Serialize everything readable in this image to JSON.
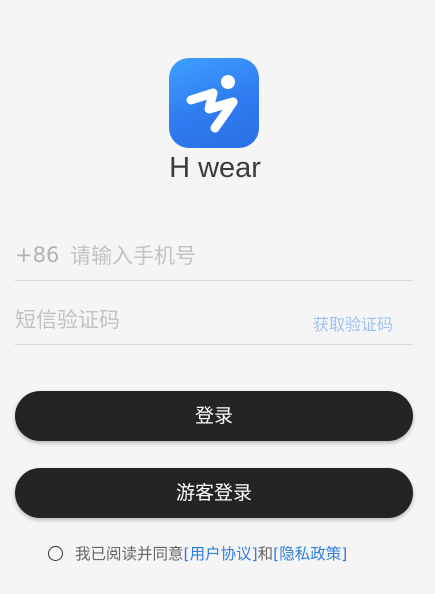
{
  "app": {
    "name": "H wear",
    "icon": "h-wear-logo-icon",
    "icon_color": "#3a8ff8"
  },
  "phone": {
    "prefix": "+86",
    "placeholder": "请输入手机号",
    "value": ""
  },
  "sms": {
    "placeholder": "短信验证码",
    "value": "",
    "get_code_label": "获取验证码"
  },
  "buttons": {
    "login_label": "登录",
    "guest_label": "游客登录"
  },
  "agreement": {
    "checked": false,
    "prefix_text": "我已阅读并同意",
    "user_agreement_link": "[用户协议]",
    "and_text": "和",
    "privacy_policy_link": "[隐私政策]"
  },
  "colors": {
    "background": "#f5f5f5",
    "button": "#242424",
    "link": "#2f7fe0",
    "get_code": "#9cc3f0"
  }
}
